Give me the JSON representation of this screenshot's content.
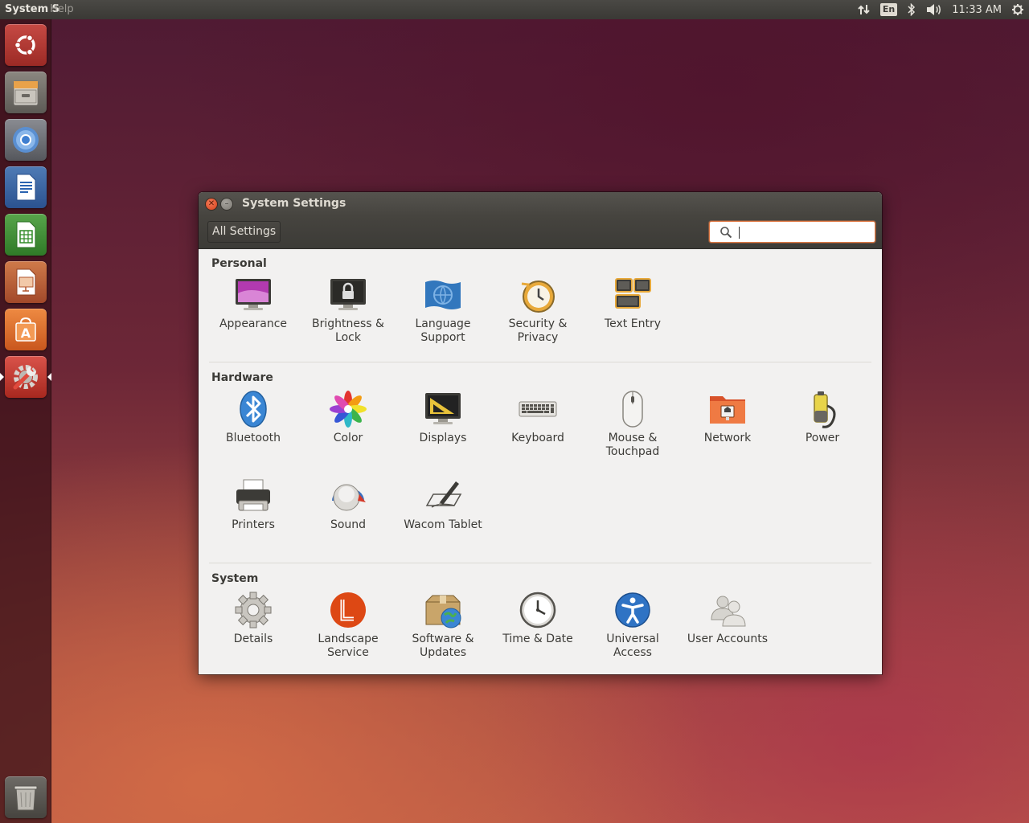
{
  "top_panel": {
    "app_title": "System Settings",
    "app_title_visible": "System S",
    "menu_ghost": "Help",
    "language": "En",
    "time": "11:33 AM"
  },
  "launcher": {
    "items": [
      {
        "name": "Dash Home",
        "icon": "ubuntu-logo-icon"
      },
      {
        "name": "Files",
        "icon": "file-cabinet-icon"
      },
      {
        "name": "Chromium Web Browser",
        "icon": "chromium-icon"
      },
      {
        "name": "LibreOffice Writer",
        "icon": "writer-icon"
      },
      {
        "name": "LibreOffice Calc",
        "icon": "calc-icon"
      },
      {
        "name": "LibreOffice Impress",
        "icon": "impress-icon"
      },
      {
        "name": "Ubuntu Software Center",
        "icon": "software-center-icon"
      },
      {
        "name": "System Settings",
        "icon": "system-settings-icon",
        "active": true
      },
      {
        "name": "Trash",
        "icon": "trash-icon"
      }
    ]
  },
  "window": {
    "title": "System Settings",
    "all_settings_label": "All Settings",
    "search": {
      "value": "",
      "placeholder": ""
    }
  },
  "sections": {
    "personal": {
      "title": "Personal",
      "items": [
        {
          "label": "Appearance",
          "icon": "appearance-icon"
        },
        {
          "label": "Brightness &\nLock",
          "icon": "brightness-lock-icon"
        },
        {
          "label": "Language\nSupport",
          "icon": "language-support-icon"
        },
        {
          "label": "Security &\nPrivacy",
          "icon": "security-privacy-icon"
        },
        {
          "label": "Text Entry",
          "icon": "text-entry-icon"
        }
      ]
    },
    "hardware": {
      "title": "Hardware",
      "items": [
        {
          "label": "Bluetooth",
          "icon": "bluetooth-icon"
        },
        {
          "label": "Color",
          "icon": "color-icon"
        },
        {
          "label": "Displays",
          "icon": "displays-icon"
        },
        {
          "label": "Keyboard",
          "icon": "keyboard-icon"
        },
        {
          "label": "Mouse &\nTouchpad",
          "icon": "mouse-icon"
        },
        {
          "label": "Network",
          "icon": "network-icon"
        },
        {
          "label": "Power",
          "icon": "power-icon"
        },
        {
          "label": "Printers",
          "icon": "printer-icon"
        },
        {
          "label": "Sound",
          "icon": "sound-icon"
        },
        {
          "label": "Wacom Tablet",
          "icon": "wacom-tablet-icon"
        }
      ]
    },
    "system": {
      "title": "System",
      "items": [
        {
          "label": "Details",
          "icon": "gear-icon"
        },
        {
          "label": "Landscape\nService",
          "icon": "landscape-icon"
        },
        {
          "label": "Software &\nUpdates",
          "icon": "software-updates-icon"
        },
        {
          "label": "Time & Date",
          "icon": "clock-icon"
        },
        {
          "label": "Universal\nAccess",
          "icon": "universal-access-icon"
        },
        {
          "label": "User Accounts",
          "icon": "user-accounts-icon"
        }
      ]
    }
  },
  "colors": {
    "accent": "#e07a45",
    "panel": "#3c3b37",
    "window_bg": "#f2f1f0"
  }
}
